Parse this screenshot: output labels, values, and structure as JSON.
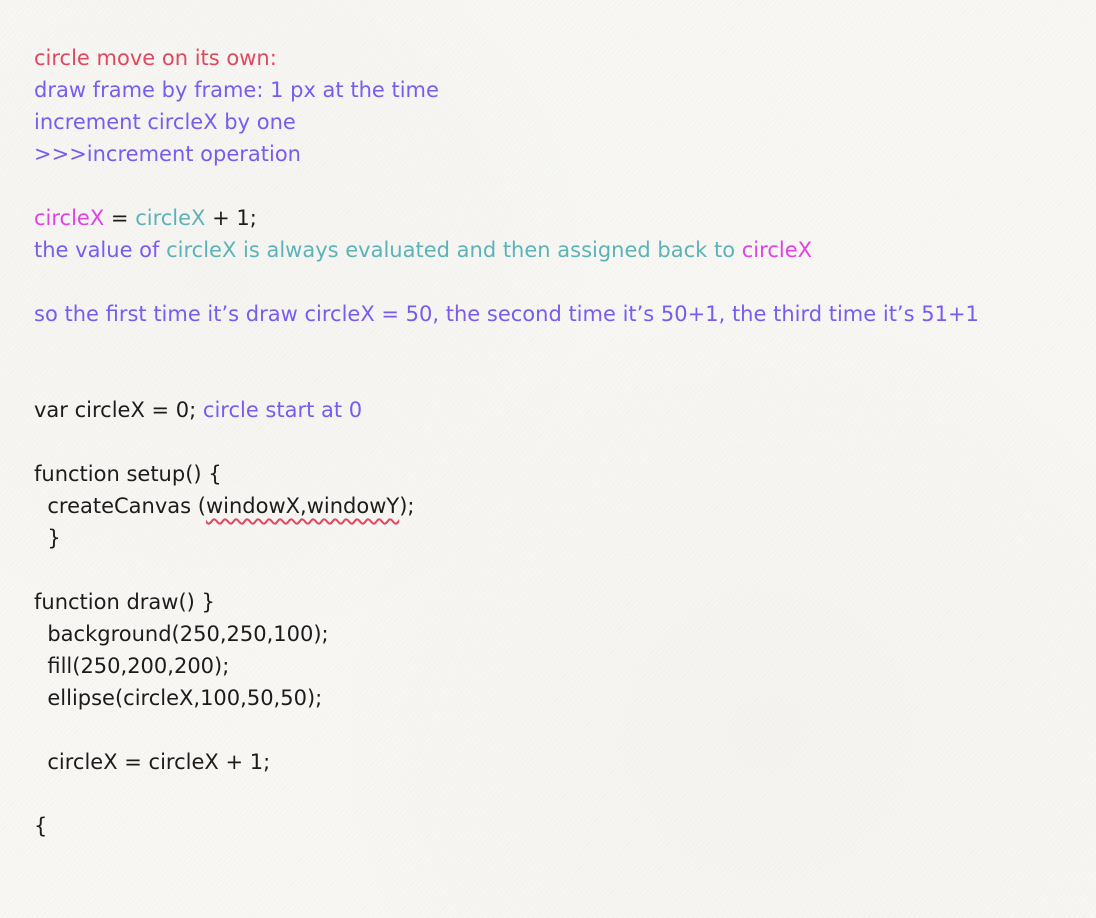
{
  "notes": {
    "l1": "circle move on its own:",
    "l2": "draw frame by frame: 1 px at the time",
    "l3": "increment circleX by one",
    "l4": ">>>increment operation"
  },
  "assign": {
    "lhs": "circleX",
    "eq": " = ",
    "rhs": "circleX",
    "rest": " + 1;"
  },
  "explain": {
    "a": "the value of ",
    "b": "circleX is always evaluated and then assigned back to ",
    "c": "circleX"
  },
  "example": "so the first time it’s draw circleX = 50, the second time it’s 50+1, the third time it’s 51+1",
  "code": {
    "var_code": "var circleX = 0; ",
    "var_comment": "circle start at 0",
    "setup_open": "function setup() {",
    "create_pre": "  createCanvas (",
    "create_args": "windowX,windowY",
    "create_post": ");",
    "setup_close": "  }",
    "draw_open": "function draw() }",
    "bg": "  background(250,250,100);",
    "fill": "  fill(250,200,200);",
    "ellipse": "  ellipse(circleX,100,50,50);",
    "increment": "  circleX = circleX + 1;",
    "brace": "{"
  },
  "colors": {
    "red": "#e0485f",
    "purple": "#7a5bf0",
    "magenta": "#e042e6",
    "teal": "#5bb3b8",
    "text": "#1c1c1c",
    "paper": "#f7f6f2"
  }
}
